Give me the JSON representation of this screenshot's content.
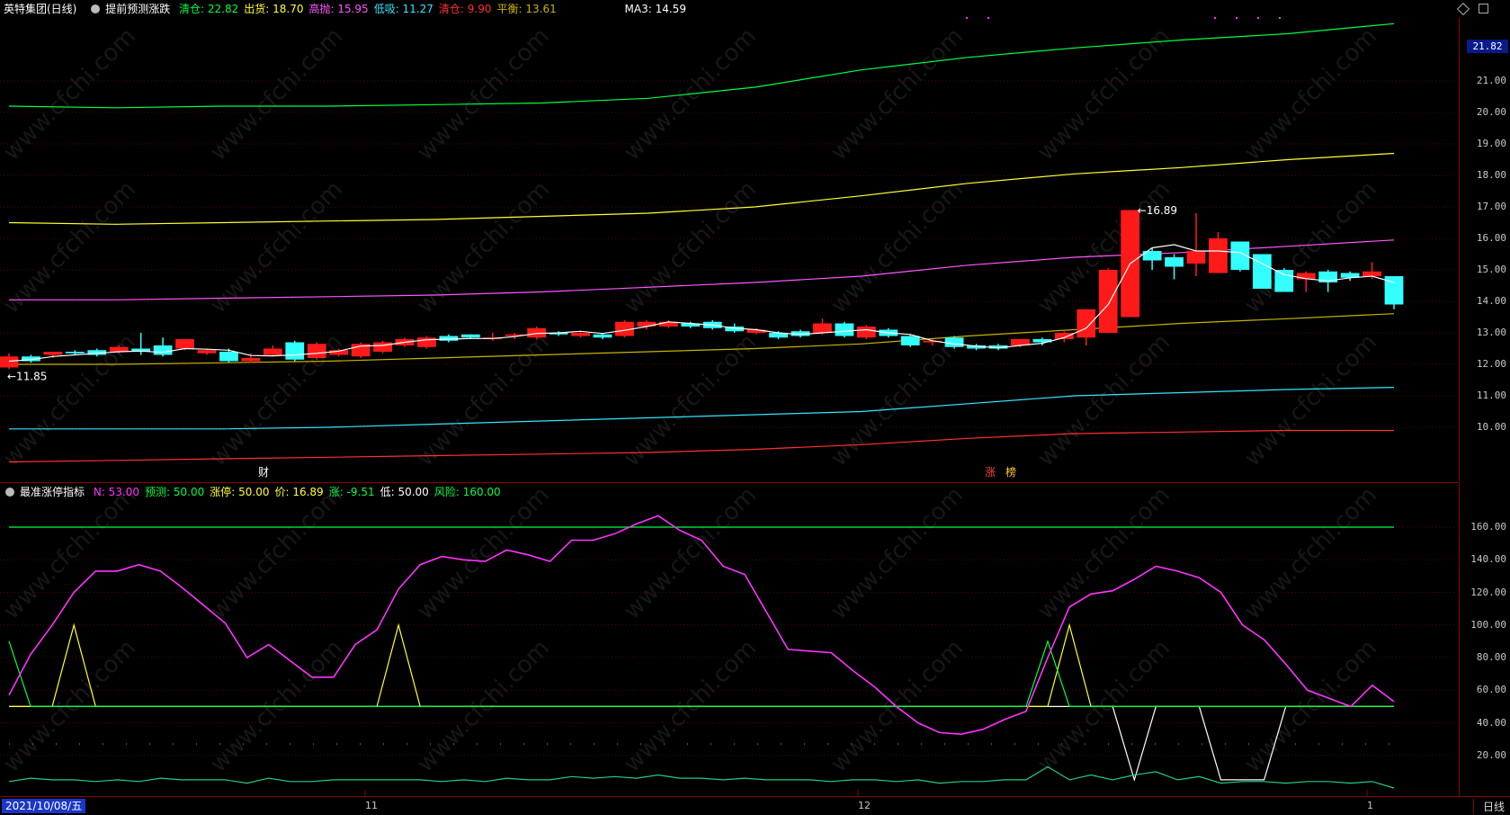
{
  "header": {
    "title": "英特集团(日线)",
    "indicator_name": "提前预测涨跌",
    "fields": [
      {
        "label": "清仓:",
        "value": "22.82",
        "color": "#00ff40"
      },
      {
        "label": "出货:",
        "value": "18.70",
        "color": "#ffff33"
      },
      {
        "label": "高抛:",
        "value": "15.95",
        "color": "#ff55ff"
      },
      {
        "label": "低吸:",
        "value": "11.27",
        "color": "#33e6ff"
      },
      {
        "label": "清仓:",
        "value": "9.90",
        "color": "#ff3030"
      },
      {
        "label": "平衡:",
        "value": "13.61",
        "color": "#c8b400"
      }
    ],
    "ma3": "MA3: 14.59"
  },
  "main_chart": {
    "price_axis": [
      "21.00",
      "20.00",
      "19.00",
      "18.00",
      "17.00",
      "16.00",
      "15.00",
      "14.00",
      "13.00",
      "12.00",
      "11.00",
      "10.00"
    ],
    "current_price": "21.82",
    "high_label": "16.89",
    "low_label": "11.85",
    "events": [
      {
        "text": "财",
        "color": "#ffffff",
        "x": 287
      },
      {
        "text": "涨",
        "color": "#ff4040",
        "x": 1095
      },
      {
        "text": "榜",
        "color": "#ffcc33",
        "x": 1118
      }
    ],
    "colors": {
      "up": "#ff1a1a",
      "down": "#33ffff",
      "ma": "#ffffff"
    }
  },
  "sub_header": {
    "name": "最准涨停指标",
    "fields": [
      {
        "label": "N:",
        "value": "53.00",
        "color": "#ff33ff"
      },
      {
        "label": "预测:",
        "value": "50.00",
        "color": "#00ff40"
      },
      {
        "label": "涨停:",
        "value": "50.00",
        "color": "#ffff33"
      },
      {
        "label": "价:",
        "value": "16.89",
        "color": "#ffff33"
      },
      {
        "label": "涨:",
        "value": "-9.51",
        "color": "#00ff40"
      },
      {
        "label": "低:",
        "value": "50.00",
        "color": "#ffffff"
      },
      {
        "label": "风险:",
        "value": "160.00",
        "color": "#00ff40"
      }
    ],
    "axis": [
      "160.00",
      "140.00",
      "120.00",
      "100.00",
      "80.00",
      "60.00",
      "40.00",
      "20.00"
    ]
  },
  "bottom": {
    "date": "2021/10/08/五",
    "months": [
      {
        "label": "11"
      },
      {
        "label": "12"
      },
      {
        "label": "1"
      }
    ],
    "period": "日线"
  },
  "watermark": "www.cfchi.com",
  "chart_data": [
    {
      "type": "candlestick",
      "title": "英特集团(日线)",
      "x": [
        0,
        1,
        2,
        3,
        4,
        5,
        6,
        7,
        8,
        9,
        10,
        11,
        12,
        13,
        14,
        15,
        16,
        17,
        18,
        19,
        20,
        21,
        22,
        23,
        24,
        25,
        26,
        27,
        28,
        29,
        30,
        31,
        32,
        33,
        34,
        35,
        36,
        37,
        38,
        39,
        40,
        41,
        42,
        43,
        44,
        45,
        46,
        47,
        48,
        49,
        50,
        51,
        52,
        53,
        54,
        55,
        56,
        57,
        58,
        59,
        60,
        61,
        62,
        63
      ],
      "open": [
        11.9,
        12.25,
        12.3,
        12.4,
        12.45,
        12.4,
        12.5,
        12.6,
        12.5,
        12.35,
        12.4,
        12.1,
        12.3,
        12.7,
        12.2,
        12.3,
        12.25,
        12.4,
        12.6,
        12.55,
        12.9,
        12.95,
        12.8,
        12.9,
        12.85,
        13.0,
        12.9,
        12.95,
        12.9,
        13.2,
        13.2,
        13.3,
        13.35,
        13.2,
        13.0,
        13.0,
        13.05,
        13.0,
        13.3,
        12.85,
        13.1,
        12.9,
        12.7,
        12.85,
        12.6,
        12.6,
        12.6,
        12.8,
        12.8,
        12.85,
        13.0,
        13.5,
        15.6,
        15.4,
        15.2,
        14.9,
        15.9,
        15.5,
        15.0,
        14.7,
        14.95,
        14.9,
        14.8,
        14.8
      ],
      "close": [
        12.25,
        12.1,
        12.4,
        12.35,
        12.3,
        12.55,
        12.4,
        12.3,
        12.8,
        12.45,
        12.1,
        12.2,
        12.5,
        12.15,
        12.65,
        12.45,
        12.65,
        12.7,
        12.8,
        12.85,
        12.75,
        12.85,
        12.85,
        12.95,
        13.15,
        12.95,
        13.0,
        12.85,
        13.35,
        13.35,
        13.35,
        13.2,
        13.15,
        13.05,
        13.1,
        12.85,
        12.9,
        13.3,
        12.9,
        13.2,
        12.9,
        12.6,
        12.75,
        12.55,
        12.5,
        12.5,
        12.8,
        12.7,
        13.0,
        13.75,
        15.0,
        16.9,
        15.3,
        15.1,
        15.6,
        16.0,
        15.0,
        14.4,
        14.3,
        14.9,
        14.6,
        14.75,
        14.95,
        13.9
      ],
      "high": [
        12.35,
        12.3,
        12.4,
        12.45,
        12.5,
        12.6,
        13.0,
        12.85,
        12.8,
        12.5,
        12.5,
        12.35,
        12.6,
        12.75,
        12.7,
        12.5,
        12.7,
        12.75,
        12.85,
        12.9,
        12.95,
        12.95,
        13.0,
        13.0,
        13.2,
        13.05,
        13.05,
        13.0,
        13.4,
        13.4,
        13.4,
        13.35,
        13.4,
        13.3,
        13.15,
        13.05,
        13.1,
        13.45,
        13.35,
        13.25,
        13.15,
        12.95,
        12.8,
        12.9,
        12.65,
        12.65,
        12.8,
        12.85,
        13.05,
        13.75,
        15.05,
        16.89,
        15.7,
        15.5,
        16.8,
        16.2,
        15.9,
        15.5,
        15.05,
        14.95,
        15.0,
        14.95,
        15.25,
        14.8
      ],
      "low": [
        11.85,
        12.05,
        12.2,
        12.3,
        12.25,
        12.35,
        12.3,
        12.25,
        12.45,
        12.3,
        12.05,
        12.05,
        12.25,
        12.1,
        12.15,
        12.25,
        12.2,
        12.35,
        12.55,
        12.5,
        12.7,
        12.8,
        12.75,
        12.8,
        12.8,
        12.9,
        12.85,
        12.8,
        12.85,
        13.1,
        13.15,
        13.15,
        13.1,
        13.0,
        12.95,
        12.8,
        12.85,
        12.95,
        12.85,
        12.8,
        12.85,
        12.55,
        12.6,
        12.5,
        12.45,
        12.45,
        12.55,
        12.6,
        12.7,
        12.6,
        13.0,
        14.8,
        15.0,
        14.7,
        14.8,
        14.9,
        14.95,
        14.4,
        14.3,
        14.3,
        14.3,
        14.65,
        14.7,
        13.75
      ],
      "ma3": [
        12.1,
        12.15,
        12.25,
        12.3,
        12.35,
        12.4,
        12.42,
        12.38,
        12.5,
        12.48,
        12.45,
        12.28,
        12.27,
        12.3,
        12.35,
        12.42,
        12.58,
        12.6,
        12.7,
        12.78,
        12.8,
        12.82,
        12.82,
        12.88,
        12.98,
        13.0,
        13.05,
        12.98,
        13.08,
        13.2,
        13.35,
        13.3,
        13.25,
        13.15,
        13.1,
        13.0,
        12.95,
        13.0,
        13.05,
        13.1,
        13.0,
        12.95,
        12.75,
        12.65,
        12.58,
        12.52,
        12.6,
        12.67,
        12.85,
        13.15,
        13.9,
        15.2,
        15.7,
        15.8,
        15.6,
        15.6,
        15.55,
        15.2,
        14.85,
        14.72,
        14.65,
        14.75,
        14.8,
        14.6
      ],
      "bands": [
        {
          "name": "清仓",
          "color": "#00ff40",
          "values": [
            20.2,
            20.15,
            20.2,
            20.2,
            20.25,
            20.3,
            20.45,
            20.8,
            21.35,
            21.75,
            22.05,
            22.3,
            22.5,
            22.82
          ]
        },
        {
          "name": "出货",
          "color": "#ffff33",
          "values": [
            16.5,
            16.45,
            16.5,
            16.55,
            16.6,
            16.7,
            16.8,
            17.0,
            17.35,
            17.75,
            18.05,
            18.25,
            18.5,
            18.7
          ]
        },
        {
          "name": "高抛",
          "color": "#ff55ff",
          "values": [
            14.05,
            14.05,
            14.1,
            14.15,
            14.2,
            14.3,
            14.45,
            14.6,
            14.8,
            15.15,
            15.4,
            15.55,
            15.75,
            15.95
          ]
        },
        {
          "name": "低吸",
          "color": "#33e6ff",
          "values": [
            9.95,
            9.95,
            9.95,
            10.0,
            10.1,
            10.2,
            10.3,
            10.4,
            10.5,
            10.75,
            11.0,
            11.1,
            11.2,
            11.27
          ]
        },
        {
          "name": "清仓",
          "color": "#ff3030",
          "values": [
            8.9,
            8.95,
            9.0,
            9.05,
            9.1,
            9.15,
            9.2,
            9.3,
            9.45,
            9.65,
            9.8,
            9.85,
            9.9,
            9.9
          ]
        },
        {
          "name": "平衡",
          "color": "#c8b400",
          "values": [
            12.0,
            12.0,
            12.05,
            12.1,
            12.2,
            12.3,
            12.4,
            12.5,
            12.65,
            12.9,
            13.1,
            13.3,
            13.45,
            13.61
          ]
        }
      ]
    },
    {
      "type": "line",
      "title": "最准涨停指标",
      "ylim": [
        0,
        175
      ],
      "series": [
        {
          "name": "N",
          "color": "#ff33ff",
          "values": [
            57,
            82,
            100,
            120,
            133,
            133,
            137,
            133,
            123,
            112,
            101,
            80,
            88,
            78,
            68,
            68,
            88,
            97,
            122,
            137,
            142,
            140,
            139,
            146,
            143,
            139,
            152,
            152,
            156,
            162,
            167,
            158,
            152,
            136,
            131,
            108,
            85,
            84,
            83,
            72,
            62,
            50,
            40,
            34,
            33,
            36,
            42,
            47,
            80,
            111,
            119,
            121,
            128,
            136,
            133,
            129,
            120,
            100,
            91,
            76,
            60,
            55,
            50,
            63,
            53
          ]
        },
        {
          "name": "涨停",
          "color": "#ffff33",
          "values": [
            50,
            50,
            50,
            100,
            50,
            50,
            50,
            50,
            50,
            50,
            50,
            50,
            50,
            50,
            50,
            50,
            50,
            50,
            100,
            50,
            50,
            50,
            50,
            50,
            50,
            50,
            50,
            50,
            50,
            50,
            50,
            50,
            50,
            50,
            50,
            50,
            50,
            50,
            50,
            50,
            50,
            50,
            50,
            50,
            50,
            50,
            50,
            50,
            50,
            100,
            50,
            50,
            50,
            50,
            50,
            50,
            50,
            50,
            50,
            50,
            50,
            50,
            50,
            50,
            50
          ]
        },
        {
          "name": "预测",
          "color": "#00ff40",
          "values": [
            90,
            50,
            50,
            50,
            50,
            50,
            50,
            50,
            50,
            50,
            50,
            50,
            50,
            50,
            50,
            50,
            50,
            50,
            50,
            50,
            50,
            50,
            50,
            50,
            50,
            50,
            50,
            50,
            50,
            50,
            50,
            50,
            50,
            50,
            50,
            50,
            50,
            50,
            50,
            50,
            50,
            50,
            50,
            50,
            50,
            50,
            50,
            50,
            90,
            50,
            50,
            50,
            50,
            50,
            50,
            50,
            50,
            50,
            50,
            50,
            50,
            50,
            50,
            50,
            50
          ]
        },
        {
          "name": "低",
          "color": "#ffffff",
          "values": [
            50,
            50,
            50,
            50,
            50,
            50,
            50,
            50,
            50,
            50,
            50,
            50,
            50,
            50,
            50,
            50,
            50,
            50,
            50,
            50,
            50,
            50,
            50,
            50,
            50,
            50,
            50,
            50,
            50,
            50,
            50,
            50,
            50,
            50,
            50,
            50,
            50,
            50,
            50,
            50,
            50,
            50,
            50,
            50,
            50,
            50,
            50,
            50,
            50,
            50,
            50,
            50,
            5,
            50,
            50,
            50,
            5,
            5,
            5,
            50,
            50,
            50,
            50,
            50,
            50
          ]
        },
        {
          "name": "涨",
          "color": "#22cc88",
          "values": [
            4,
            6,
            5,
            5,
            4,
            5,
            4,
            6,
            5,
            5,
            5,
            3,
            6,
            4,
            4,
            5,
            5,
            5,
            5,
            5,
            4,
            5,
            4,
            6,
            5,
            5,
            7,
            6,
            7,
            6,
            8,
            6,
            6,
            5,
            6,
            5,
            5,
            5,
            4,
            5,
            5,
            4,
            5,
            3,
            4,
            4,
            5,
            5,
            13,
            5,
            8,
            5,
            8,
            10,
            5,
            7,
            3,
            4,
            4,
            3,
            4,
            4,
            3,
            4,
            0
          ]
        },
        {
          "name": "风险",
          "color": "#00ff40",
          "values": [
            160,
            160,
            160,
            160,
            160,
            160,
            160,
            160,
            160,
            160,
            160,
            160,
            160,
            160,
            160,
            160,
            160,
            160,
            160,
            160,
            160,
            160,
            160,
            160,
            160,
            160,
            160,
            160,
            160,
            160,
            160,
            160,
            160,
            160,
            160,
            160,
            160,
            160,
            160,
            160,
            160,
            160,
            160,
            160,
            160,
            160,
            160,
            160,
            160,
            160,
            160,
            160,
            160,
            160,
            160,
            160,
            160,
            160,
            160,
            160,
            160,
            160,
            160,
            160,
            160
          ]
        }
      ]
    }
  ]
}
